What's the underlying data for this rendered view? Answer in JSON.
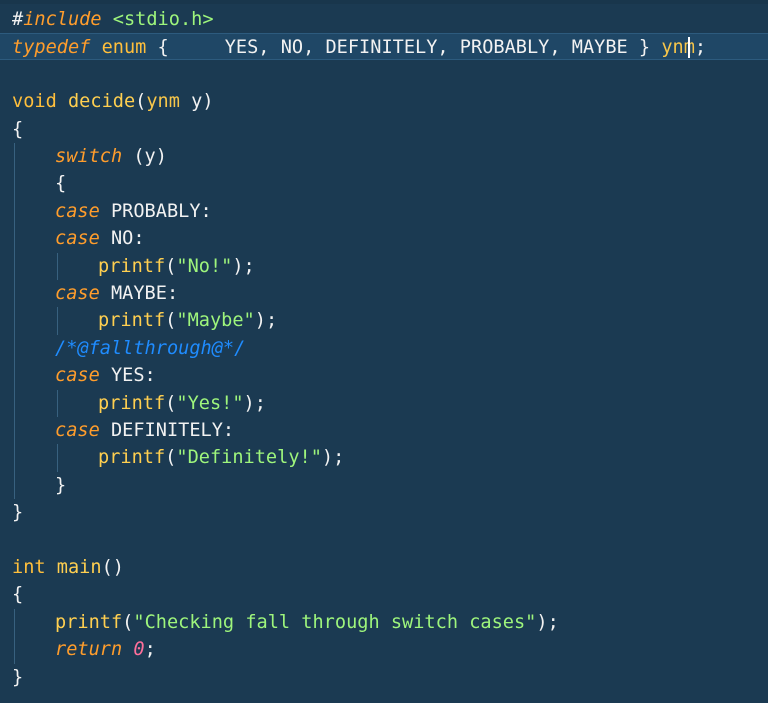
{
  "editor": {
    "language": "C",
    "lines": [
      {
        "parts": [
          {
            "text": "#",
            "cls": "pp"
          },
          {
            "text": "include",
            "cls": "kw-i"
          },
          {
            "text": " ",
            "cls": "pp"
          },
          {
            "text": "<stdio.h>",
            "cls": "hdr"
          }
        ]
      },
      {
        "parts": [
          {
            "text": "typedef",
            "cls": "kw-i"
          },
          {
            "text": " ",
            "cls": "pp"
          },
          {
            "text": "enum",
            "cls": "kw"
          },
          {
            "text": " {     YES, NO, DEFINITELY, PROBABLY, MAYBE } ",
            "cls": "id"
          },
          {
            "text": "ynm",
            "cls": "type"
          },
          {
            "text": ";",
            "cls": "punc"
          }
        ]
      },
      {
        "parts": []
      },
      {
        "parts": [
          {
            "text": "void",
            "cls": "kw"
          },
          {
            "text": " ",
            "cls": "pp"
          },
          {
            "text": "decide",
            "cls": "fn"
          },
          {
            "text": "(",
            "cls": "punc"
          },
          {
            "text": "ynm",
            "cls": "type"
          },
          {
            "text": " y)",
            "cls": "id"
          }
        ]
      },
      {
        "parts": [
          {
            "text": "{",
            "cls": "punc"
          }
        ]
      },
      {
        "parts": [
          {
            "text": "switch",
            "cls": "kw-i"
          },
          {
            "text": " (y)",
            "cls": "id"
          }
        ]
      },
      {
        "parts": [
          {
            "text": "{",
            "cls": "punc"
          }
        ]
      },
      {
        "parts": [
          {
            "text": "case",
            "cls": "kw-i"
          },
          {
            "text": " PROBABLY:",
            "cls": "id"
          }
        ]
      },
      {
        "parts": [
          {
            "text": "case",
            "cls": "kw-i"
          },
          {
            "text": " NO:",
            "cls": "id"
          }
        ]
      },
      {
        "parts": [
          {
            "text": "printf",
            "cls": "fn"
          },
          {
            "text": "(",
            "cls": "punc"
          },
          {
            "text": "\"No!\"",
            "cls": "str"
          },
          {
            "text": ");",
            "cls": "punc"
          }
        ]
      },
      {
        "parts": [
          {
            "text": "case",
            "cls": "kw-i"
          },
          {
            "text": " MAYBE:",
            "cls": "id"
          }
        ]
      },
      {
        "parts": [
          {
            "text": "printf",
            "cls": "fn"
          },
          {
            "text": "(",
            "cls": "punc"
          },
          {
            "text": "\"Maybe\"",
            "cls": "str"
          },
          {
            "text": ");",
            "cls": "punc"
          }
        ]
      },
      {
        "parts": [
          {
            "text": "/*@fallthrough@*/",
            "cls": "cmt"
          }
        ]
      },
      {
        "parts": [
          {
            "text": "case",
            "cls": "kw-i"
          },
          {
            "text": " YES:",
            "cls": "id"
          }
        ]
      },
      {
        "parts": [
          {
            "text": "printf",
            "cls": "fn"
          },
          {
            "text": "(",
            "cls": "punc"
          },
          {
            "text": "\"Yes!\"",
            "cls": "str"
          },
          {
            "text": ");",
            "cls": "punc"
          }
        ]
      },
      {
        "parts": [
          {
            "text": "case",
            "cls": "kw-i"
          },
          {
            "text": " DEFINITELY:",
            "cls": "id"
          }
        ]
      },
      {
        "parts": [
          {
            "text": "printf",
            "cls": "fn"
          },
          {
            "text": "(",
            "cls": "punc"
          },
          {
            "text": "\"Definitely!\"",
            "cls": "str"
          },
          {
            "text": ");",
            "cls": "punc"
          }
        ]
      },
      {
        "parts": [
          {
            "text": "}",
            "cls": "punc"
          }
        ]
      },
      {
        "parts": [
          {
            "text": "}",
            "cls": "punc"
          }
        ]
      },
      {
        "parts": []
      },
      {
        "parts": [
          {
            "text": "int",
            "cls": "kw"
          },
          {
            "text": " ",
            "cls": "pp"
          },
          {
            "text": "main",
            "cls": "fn"
          },
          {
            "text": "()",
            "cls": "punc"
          }
        ]
      },
      {
        "parts": [
          {
            "text": "{",
            "cls": "punc"
          }
        ]
      },
      {
        "parts": [
          {
            "text": "printf",
            "cls": "fn"
          },
          {
            "text": "(",
            "cls": "punc"
          },
          {
            "text": "\"Checking fall through switch cases\"",
            "cls": "str"
          },
          {
            "text": ");",
            "cls": "punc"
          }
        ]
      },
      {
        "parts": [
          {
            "text": "return",
            "cls": "kw-i"
          },
          {
            "text": " ",
            "cls": "pp"
          },
          {
            "text": "0",
            "cls": "num"
          },
          {
            "text": ";",
            "cls": "punc"
          }
        ]
      },
      {
        "parts": [
          {
            "text": "}",
            "cls": "punc"
          }
        ]
      }
    ]
  },
  "colors": {
    "background": "#1b3a52",
    "current_line": "#1f4766",
    "keyword_italic": "#ff9d2c",
    "keyword": "#ffbf3c",
    "function": "#ffcf50",
    "string": "#9ef57c",
    "comment": "#1f8cff",
    "number": "#ff6f9b"
  }
}
